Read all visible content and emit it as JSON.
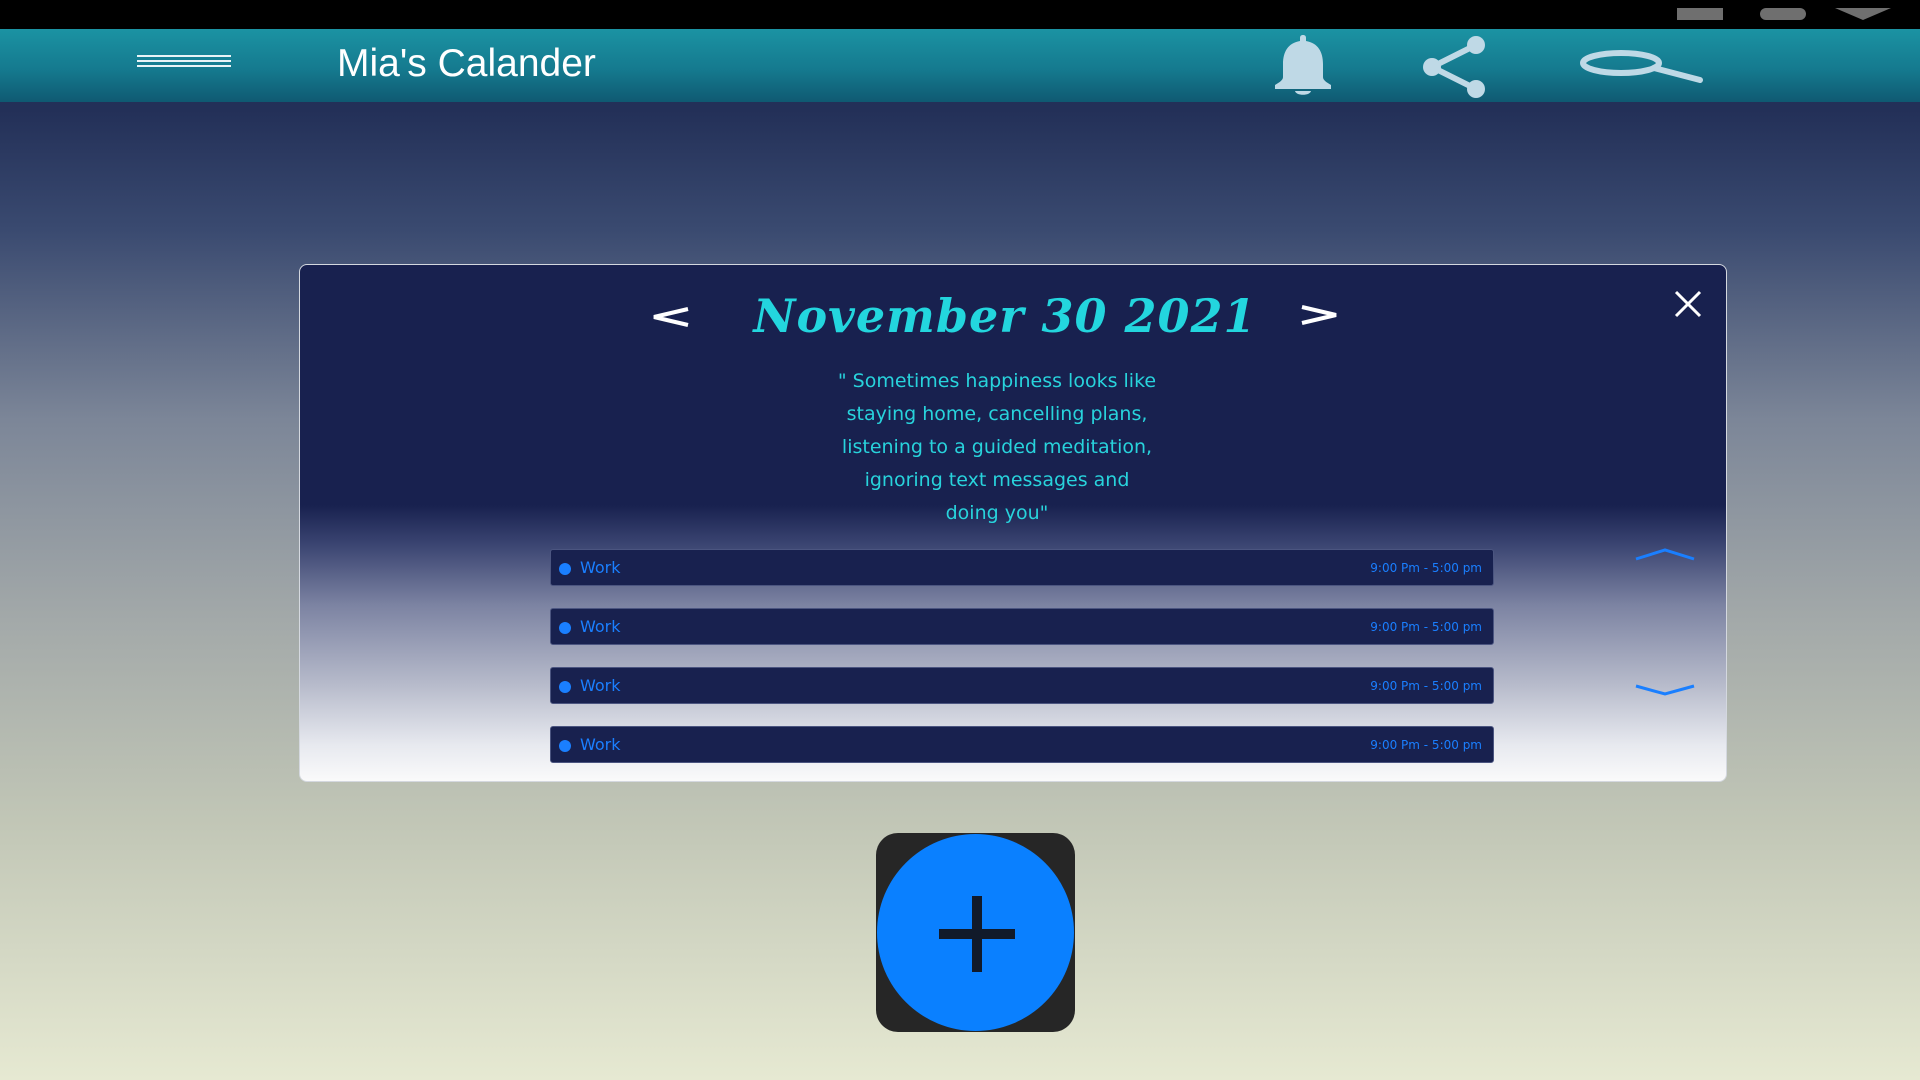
{
  "header": {
    "title": "Mia's Calander",
    "icons": [
      "menu-icon",
      "bell-icon",
      "share-icon",
      "search-icon"
    ]
  },
  "modal": {
    "date": "November 30 2021",
    "quote_lines": [
      "\" Sometimes happiness looks like",
      "staying home, cancelling plans,",
      "listening to a guided meditation,",
      "ignoring text messages and",
      "doing you\""
    ],
    "events": [
      {
        "label": "Work",
        "time": "9:00 Pm - 5:00 pm"
      },
      {
        "label": "Work",
        "time": "9:00 Pm - 5:00 pm"
      },
      {
        "label": "Work",
        "time": "9:00 Pm - 5:00 pm"
      },
      {
        "label": "Work",
        "time": "9:00 Pm - 5:00 pm"
      }
    ]
  },
  "colors": {
    "accent": "#23d6de",
    "event_text": "#1a7fff",
    "add_button": "#0a80ff",
    "header": "#157a8f"
  }
}
